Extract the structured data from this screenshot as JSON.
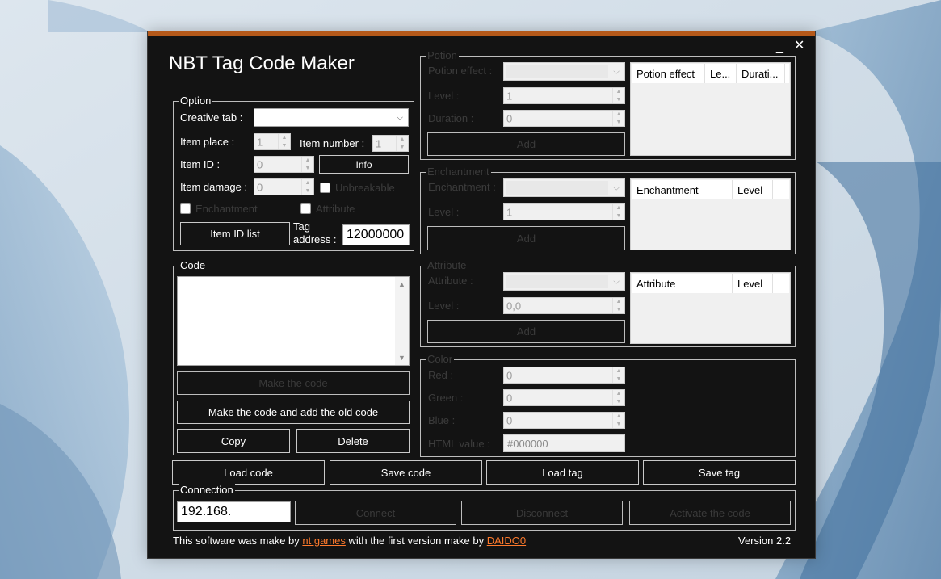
{
  "window": {
    "title": "NBT Tag Code Maker",
    "minimize_glyph": "_",
    "close_glyph": "✕",
    "accent_color": "#b5591a"
  },
  "option": {
    "legend": "Option",
    "creative_tab_label": "Creative tab :",
    "creative_tab_value": "",
    "item_place_label": "Item place :",
    "item_place_value": "1",
    "item_number_label": "Item number :",
    "item_number_value": "1",
    "item_id_label": "Item ID :",
    "item_id_value": "0",
    "info_button": "Info",
    "item_damage_label": "Item damage :",
    "item_damage_value": "0",
    "unbreakable_label": "Unbreakable",
    "enchantment_label": "Enchantment",
    "attribute_label": "Attribute",
    "item_id_list_button": "Item ID list",
    "tag_address_label_1": "Tag",
    "tag_address_label_2": "address :",
    "tag_address_value": "12000000"
  },
  "code": {
    "legend": "Code",
    "text": "",
    "make_code_button": "Make the code",
    "make_add_button": "Make the code and add the old code",
    "copy_button": "Copy",
    "delete_button": "Delete"
  },
  "potion": {
    "legend": "Potion",
    "effect_label": "Potion effect :",
    "level_label": "Level :",
    "level_value": "1",
    "duration_label": "Duration :",
    "duration_value": "0",
    "add_button": "Add",
    "columns": [
      "Potion effect",
      "Le...",
      "Durati..."
    ]
  },
  "enchantment": {
    "legend": "Enchantment",
    "enchantment_label": "Enchantment :",
    "level_label": "Level :",
    "level_value": "1",
    "add_button": "Add",
    "columns": [
      "Enchantment",
      "Level"
    ]
  },
  "attribute": {
    "legend": "Attribute",
    "attribute_label": "Attribute :",
    "level_label": "Level :",
    "level_value": "0,0",
    "add_button": "Add",
    "columns": [
      "Attribute",
      "Level"
    ]
  },
  "color": {
    "legend": "Color",
    "red_label": "Red :",
    "red_value": "0",
    "green_label": "Green :",
    "green_value": "0",
    "blue_label": "Blue :",
    "blue_value": "0",
    "html_label": "HTML value :",
    "html_value": "#000000"
  },
  "actions": {
    "load_code": "Load code",
    "save_code": "Save code",
    "load_tag": "Load tag",
    "save_tag": "Save tag"
  },
  "connection": {
    "legend": "Connection",
    "ip_value": "192.168.",
    "connect_button": "Connect",
    "disconnect_button": "Disconnect",
    "activate_button": "Activate the code"
  },
  "footer": {
    "text_1": "This software was make by ",
    "link_1": "nt games",
    "text_2": " with the first version make by ",
    "link_2": "DAIDO0",
    "version": "Version 2.2"
  }
}
